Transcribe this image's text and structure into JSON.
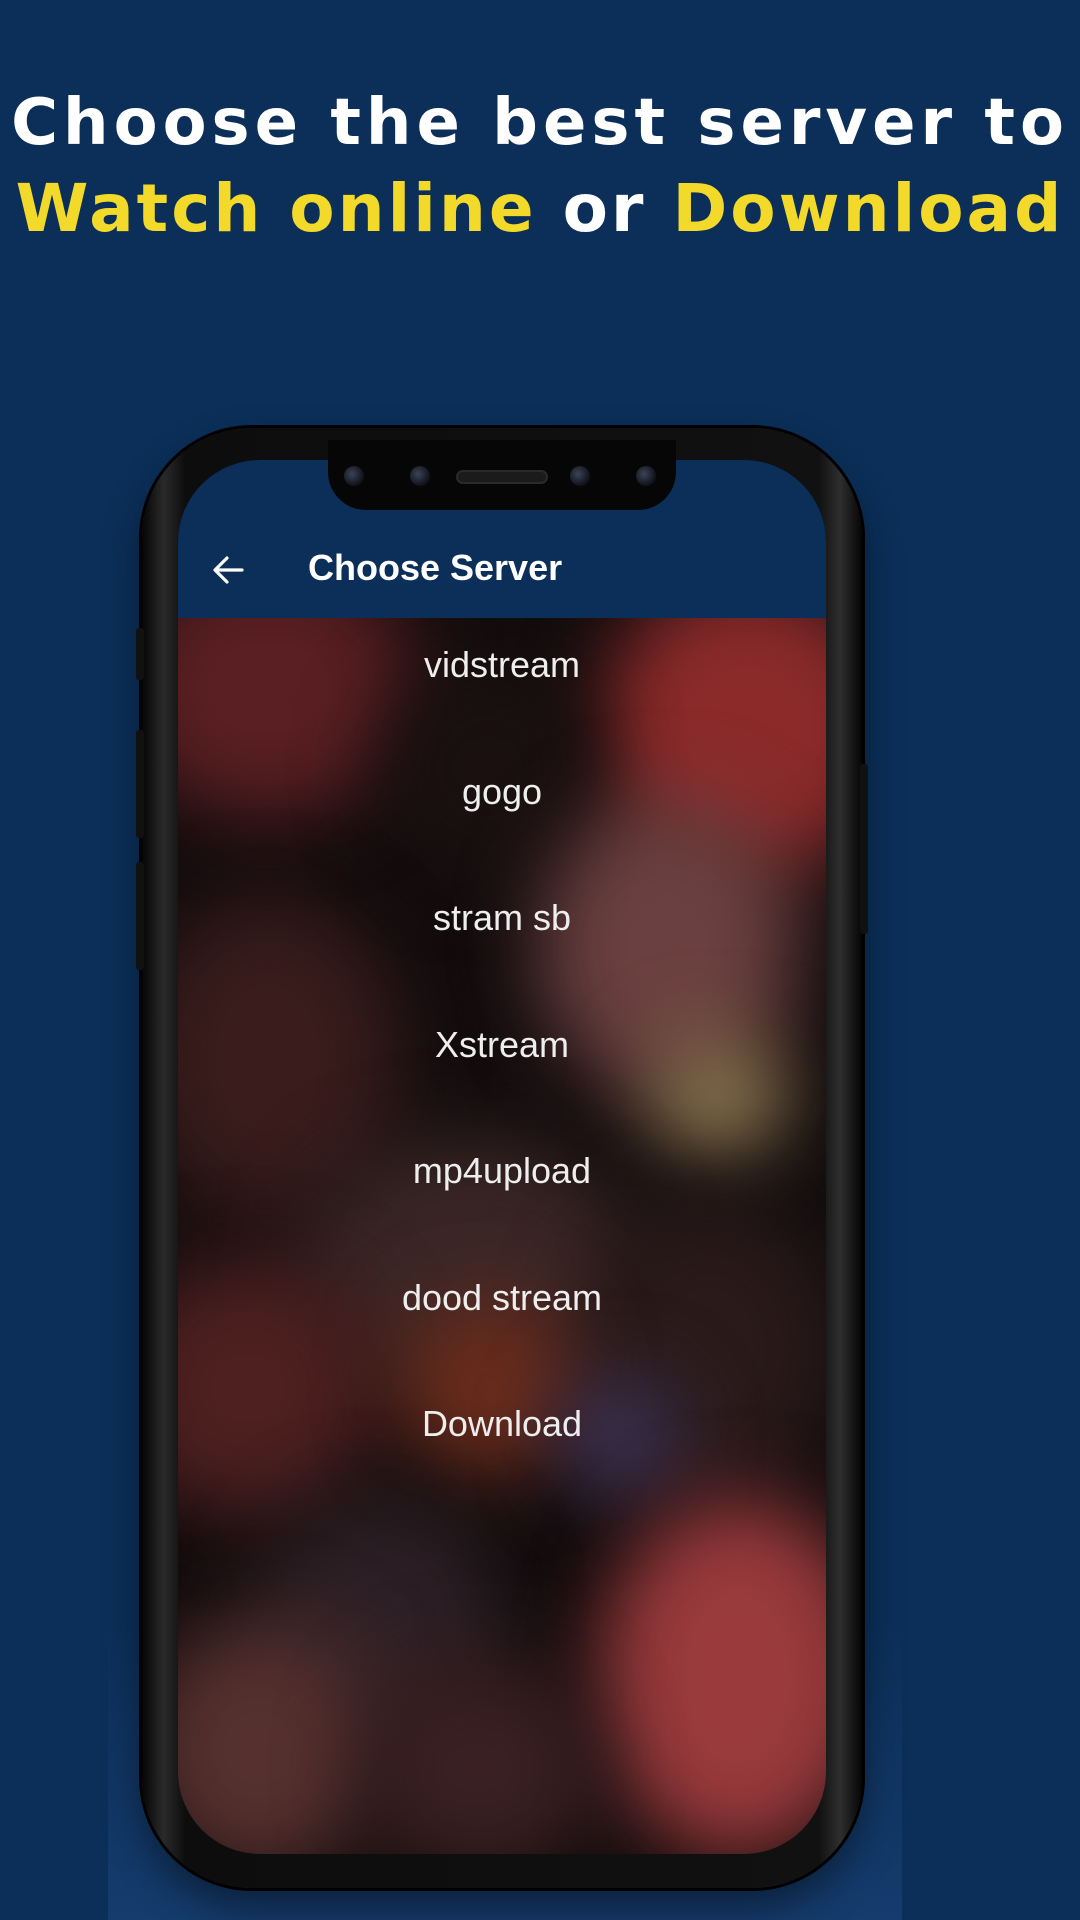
{
  "headline": {
    "line1": "Choose the best server to",
    "line2_part1": "Watch online",
    "line2_part2": "or",
    "line2_part3": "Download"
  },
  "appbar": {
    "title": "Choose Server",
    "back_icon": "arrow-left-icon"
  },
  "servers": [
    {
      "label": "vidstream"
    },
    {
      "label": "gogo"
    },
    {
      "label": "stram sb"
    },
    {
      "label": "Xstream"
    },
    {
      "label": "mp4upload"
    },
    {
      "label": "dood stream"
    },
    {
      "label": "Download"
    }
  ],
  "colors": {
    "background": "#0b2f59",
    "accent": "#f3da2a",
    "text": "#ffffff"
  }
}
